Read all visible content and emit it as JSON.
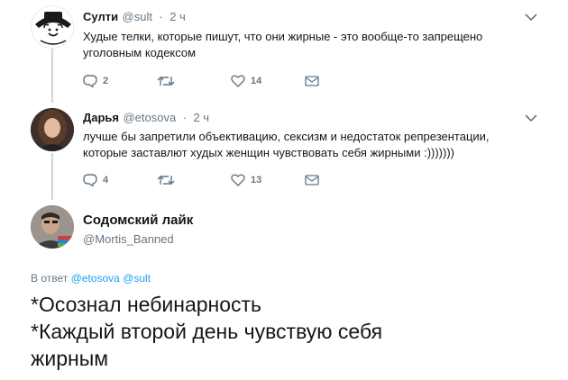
{
  "tweets": [
    {
      "name": "Султи",
      "handle": "@sult",
      "time": "2 ч",
      "text": "Худые телки, которые пишут, что они жирные - это вообще-то запрещено уголовным кодексом",
      "replies": "2",
      "retweets": "",
      "likes": "14",
      "avatar_icon": "cartoon-face-avatar"
    },
    {
      "name": "Дарья",
      "handle": "@etosova",
      "time": "2 ч",
      "text": "лучше бы запретили объективацию, сексизм и недостаток репрезентации, которые заставлют худых женщин чувствовать себя жирными :)))))))",
      "replies": "4",
      "retweets": "",
      "likes": "13",
      "avatar_icon": "photo-avatar"
    }
  ],
  "main_tweet": {
    "name": "Содомский лайк",
    "handle": "@Mortis_Banned",
    "reply_prefix": "В ответ",
    "reply_user1": "@etosova",
    "reply_user2": "@sult",
    "text_line1": "*Осознал небинарность",
    "text_line2": "*Каждый второй день чувствую себя",
    "text_line3": "жирным"
  },
  "colors": {
    "link": "#1da1f2",
    "secondary": "#657786",
    "thread_line": "#ccd6dd"
  }
}
